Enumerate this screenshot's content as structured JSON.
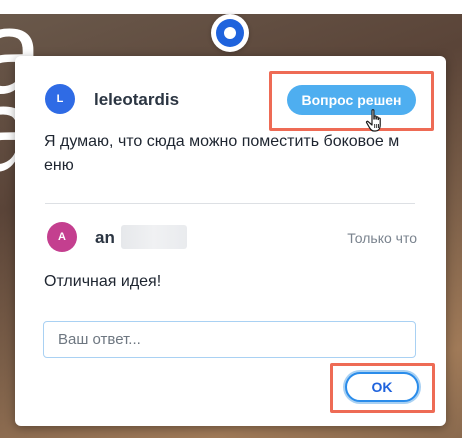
{
  "background": {
    "glyphs": [
      "a",
      "a"
    ]
  },
  "comment": {
    "avatar_initial": "L",
    "author": "leleotardis",
    "resolve_button_label": "Вопрос решен",
    "text": "Я думаю, что сюда можно поместить боковое м\nеню"
  },
  "reply": {
    "avatar_initial": "A",
    "author_visible": "an",
    "timestamp": "Только что",
    "text": "Отличная идея!"
  },
  "reply_input": {
    "placeholder": "Ваш ответ..."
  },
  "ok_button": {
    "label": "OK"
  },
  "colors": {
    "pin_blue": "#1f63dd",
    "resolve_button_bg": "#4eaef0",
    "highlight_box": "#ee6b55",
    "avatar_l": "#2f6be5",
    "avatar_a": "#c43f8f"
  },
  "icons": [
    "pin-marker-icon",
    "pointer-hand-cursor-icon"
  ]
}
